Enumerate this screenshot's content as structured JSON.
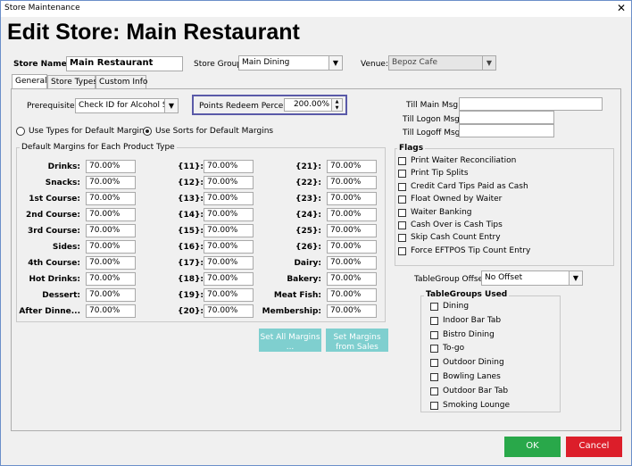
{
  "window": {
    "title": "Store  Maintenance",
    "close": "✕"
  },
  "header": {
    "title": "Edit Store: Main Restaurant"
  },
  "top": {
    "store_name_label": "Store Name:",
    "store_name_value": "Main Restaurant",
    "store_group_label": "Store Group:",
    "store_group_value": "Main Dining",
    "venue_label": "Venue:",
    "venue_value": "Bepoz Cafe"
  },
  "tabs": [
    "General",
    "Store Types",
    "Custom Info"
  ],
  "general": {
    "prerequisite_label": "Prerequisite:",
    "prerequisite_value": "Check ID for Alcohol Sa",
    "points_label": "Points Redeem Percent:",
    "points_value": "200.00%",
    "radio_types": "Use Types for Default Margins",
    "radio_sorts": "Use Sorts for Default Margins",
    "margins_group": "Default Margins for Each Product Type",
    "margins_col1": [
      {
        "label": "Drinks:",
        "value": "70.00%"
      },
      {
        "label": "Snacks:",
        "value": "70.00%"
      },
      {
        "label": "1st Course:",
        "value": "70.00%"
      },
      {
        "label": "2nd Course:",
        "value": "70.00%"
      },
      {
        "label": "3rd Course:",
        "value": "70.00%"
      },
      {
        "label": "Sides:",
        "value": "70.00%"
      },
      {
        "label": "4th Course:",
        "value": "70.00%"
      },
      {
        "label": "Hot Drinks:",
        "value": "70.00%"
      },
      {
        "label": "Dessert:",
        "value": "70.00%"
      },
      {
        "label": "After Dinne...",
        "value": "70.00%"
      }
    ],
    "margins_col2": [
      {
        "label": "{11}:",
        "value": "70.00%"
      },
      {
        "label": "{12}:",
        "value": "70.00%"
      },
      {
        "label": "{13}:",
        "value": "70.00%"
      },
      {
        "label": "{14}:",
        "value": "70.00%"
      },
      {
        "label": "{15}:",
        "value": "70.00%"
      },
      {
        "label": "{16}:",
        "value": "70.00%"
      },
      {
        "label": "{17}:",
        "value": "70.00%"
      },
      {
        "label": "{18}:",
        "value": "70.00%"
      },
      {
        "label": "{19}:",
        "value": "70.00%"
      },
      {
        "label": "{20}:",
        "value": "70.00%"
      }
    ],
    "margins_col3": [
      {
        "label": "{21}:",
        "value": "70.00%"
      },
      {
        "label": "{22}:",
        "value": "70.00%"
      },
      {
        "label": "{23}:",
        "value": "70.00%"
      },
      {
        "label": "{24}:",
        "value": "70.00%"
      },
      {
        "label": "{25}:",
        "value": "70.00%"
      },
      {
        "label": "{26}:",
        "value": "70.00%"
      },
      {
        "label": "Dairy:",
        "value": "70.00%"
      },
      {
        "label": "Bakery:",
        "value": "70.00%"
      },
      {
        "label": "Meat  Fish:",
        "value": "70.00%"
      },
      {
        "label": "Membership:",
        "value": "70.00%"
      }
    ],
    "set_all_btn": "Set All Margins ...",
    "set_sales_btn": "Set Margins from Sales",
    "till_main_label": "Till Main Msg:",
    "till_logon_label": "Till Logon Msg:",
    "till_logoff_label": "Till Logoff Msg:",
    "flags_title": "Flags",
    "flags": [
      "Print Waiter Reconciliation",
      "Print Tip Splits",
      "Credit Card Tips Paid as Cash",
      "Float Owned by Waiter",
      "Waiter Banking",
      "Cash Over is Cash Tips",
      "Skip Cash Count Entry",
      "Force EFTPOS Tip Count Entry"
    ],
    "tablegroup_offset_label": "TableGroup Offset:",
    "tablegroup_offset_value": "No Offset",
    "tablegroups_title": "TableGroups Used",
    "tablegroups": [
      "Dining",
      "Indoor Bar Tab",
      "Bistro Dining",
      "To-go",
      "Outdoor Dining",
      "Bowling Lanes",
      "Outdoor Bar Tab",
      "Smoking Lounge"
    ]
  },
  "footer": {
    "ok": "OK",
    "cancel": "Cancel"
  },
  "colors": {
    "accent_border": "#5a5aa8",
    "ok_green": "#29a84a",
    "cancel_red": "#dc1e2a",
    "teal_button": "#7fcfcf"
  }
}
